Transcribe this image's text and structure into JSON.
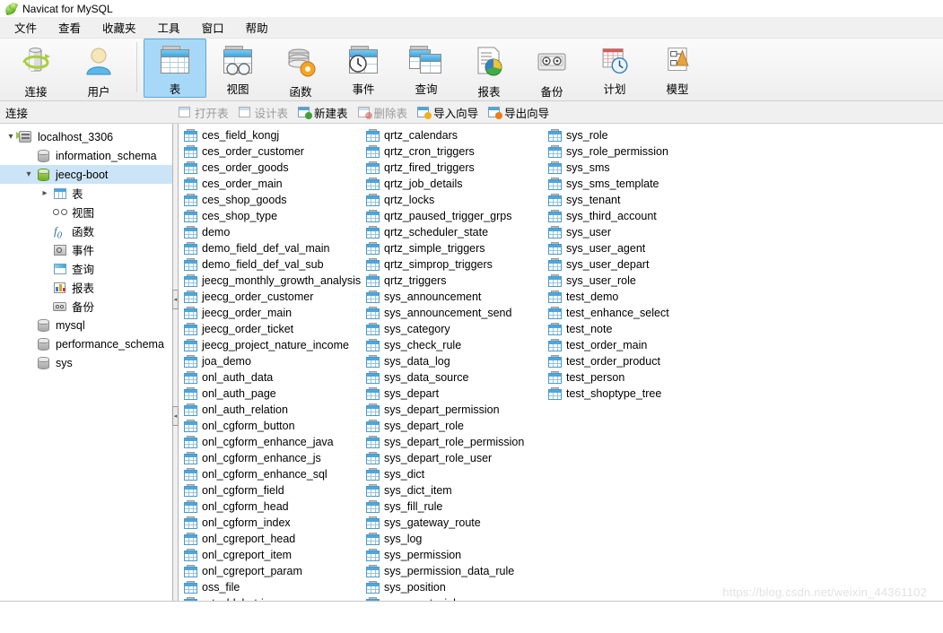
{
  "window": {
    "title": "Navicat for MySQL",
    "icon": "navicat-leaf-icon"
  },
  "menubar": {
    "items": [
      {
        "label": "文件",
        "name": "menu-file"
      },
      {
        "label": "查看",
        "name": "menu-view"
      },
      {
        "label": "收藏夹",
        "name": "menu-favorites"
      },
      {
        "label": "工具",
        "name": "menu-tools"
      },
      {
        "label": "窗口",
        "name": "menu-window"
      },
      {
        "label": "帮助",
        "name": "menu-help"
      }
    ]
  },
  "toolbar": {
    "items": [
      {
        "label": "连接",
        "icon": "connection-icon",
        "active": false
      },
      {
        "label": "用户",
        "icon": "user-icon",
        "active": false
      },
      {
        "label": "表",
        "icon": "table-icon",
        "active": true
      },
      {
        "label": "视图",
        "icon": "view-icon",
        "active": false
      },
      {
        "label": "函数",
        "icon": "function-icon",
        "active": false
      },
      {
        "label": "事件",
        "icon": "event-icon",
        "active": false
      },
      {
        "label": "查询",
        "icon": "query-icon",
        "active": false
      },
      {
        "label": "报表",
        "icon": "report-icon",
        "active": false
      },
      {
        "label": "备份",
        "icon": "backup-icon",
        "active": false
      },
      {
        "label": "计划",
        "icon": "schedule-icon",
        "active": false
      },
      {
        "label": "模型",
        "icon": "model-icon",
        "active": false
      }
    ]
  },
  "subbar": {
    "connection_label": "连接",
    "actions": [
      {
        "label": "打开表",
        "icon": "open-table-icon",
        "disabled": true
      },
      {
        "label": "设计表",
        "icon": "design-table-icon",
        "disabled": true
      },
      {
        "label": "新建表",
        "icon": "new-table-icon",
        "disabled": false
      },
      {
        "label": "删除表",
        "icon": "delete-table-icon",
        "disabled": true
      },
      {
        "label": "导入向导",
        "icon": "import-wizard-icon",
        "disabled": false
      },
      {
        "label": "导出向导",
        "icon": "export-wizard-icon",
        "disabled": false
      }
    ]
  },
  "sidebar": {
    "tree": [
      {
        "label": "localhost_3306",
        "icon": "server-icon",
        "indent": 0,
        "chevron": "down",
        "selected": false
      },
      {
        "label": "information_schema",
        "icon": "database-icon",
        "indent": 1,
        "chevron": "",
        "selected": false
      },
      {
        "label": "jeecg-boot",
        "icon": "database-active-icon",
        "indent": 1,
        "chevron": "down",
        "selected": true
      },
      {
        "label": "表",
        "icon": "tables-folder-icon",
        "indent": 2,
        "chevron": "right",
        "selected": false
      },
      {
        "label": "视图",
        "icon": "views-icon",
        "indent": 2,
        "chevron": "",
        "selected": false
      },
      {
        "label": "函数",
        "icon": "functions-icon",
        "indent": 2,
        "chevron": "",
        "selected": false
      },
      {
        "label": "事件",
        "icon": "events-icon",
        "indent": 2,
        "chevron": "",
        "selected": false
      },
      {
        "label": "查询",
        "icon": "queries-icon",
        "indent": 2,
        "chevron": "",
        "selected": false
      },
      {
        "label": "报表",
        "icon": "reports-icon",
        "indent": 2,
        "chevron": "",
        "selected": false
      },
      {
        "label": "备份",
        "icon": "backups-icon",
        "indent": 2,
        "chevron": "",
        "selected": false
      },
      {
        "label": "mysql",
        "icon": "database-icon",
        "indent": 1,
        "chevron": "",
        "selected": false
      },
      {
        "label": "performance_schema",
        "icon": "database-icon",
        "indent": 1,
        "chevron": "",
        "selected": false
      },
      {
        "label": "sys",
        "icon": "database-icon",
        "indent": 1,
        "chevron": "",
        "selected": false
      }
    ]
  },
  "main": {
    "tables": [
      "ces_field_kongj",
      "ces_order_customer",
      "ces_order_goods",
      "ces_order_main",
      "ces_shop_goods",
      "ces_shop_type",
      "demo",
      "demo_field_def_val_main",
      "demo_field_def_val_sub",
      "jeecg_monthly_growth_analysis",
      "jeecg_order_customer",
      "jeecg_order_main",
      "jeecg_order_ticket",
      "jeecg_project_nature_income",
      "joa_demo",
      "onl_auth_data",
      "onl_auth_page",
      "onl_auth_relation",
      "onl_cgform_button",
      "onl_cgform_enhance_java",
      "onl_cgform_enhance_js",
      "onl_cgform_enhance_sql",
      "onl_cgform_field",
      "onl_cgform_head",
      "onl_cgform_index",
      "onl_cgreport_head",
      "onl_cgreport_item",
      "onl_cgreport_param",
      "oss_file",
      "qrtz_blob_triggers",
      "qrtz_calendars",
      "qrtz_cron_triggers",
      "qrtz_fired_triggers",
      "qrtz_job_details",
      "qrtz_locks",
      "qrtz_paused_trigger_grps",
      "qrtz_scheduler_state",
      "qrtz_simple_triggers",
      "qrtz_simprop_triggers",
      "qrtz_triggers",
      "sys_announcement",
      "sys_announcement_send",
      "sys_category",
      "sys_check_rule",
      "sys_data_log",
      "sys_data_source",
      "sys_depart",
      "sys_depart_permission",
      "sys_depart_role",
      "sys_depart_role_permission",
      "sys_depart_role_user",
      "sys_dict",
      "sys_dict_item",
      "sys_fill_rule",
      "sys_gateway_route",
      "sys_log",
      "sys_permission",
      "sys_permission_data_rule",
      "sys_position",
      "sys_quartz_job",
      "sys_role",
      "sys_role_permission",
      "sys_sms",
      "sys_sms_template",
      "sys_tenant",
      "sys_third_account",
      "sys_user",
      "sys_user_agent",
      "sys_user_depart",
      "sys_user_role",
      "test_demo",
      "test_enhance_select",
      "test_note",
      "test_order_main",
      "test_order_product",
      "test_person",
      "test_shoptype_tree"
    ]
  },
  "statusbar": {
    "watermark": "https://blog.csdn.net/weixin_44361102"
  },
  "colors": {
    "selection": "#cce4f7",
    "toolbar_active": "#a8d8f8",
    "table_icon_blue": "#4aa7e0",
    "menubar_bg": "#f0f0f0"
  }
}
